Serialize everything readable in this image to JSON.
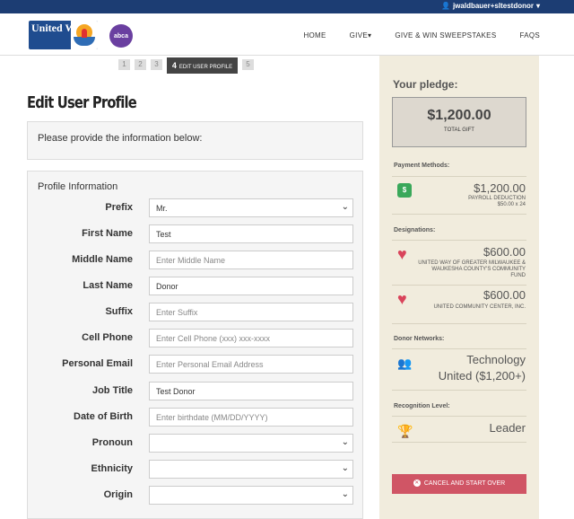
{
  "header": {
    "user": "jwaldbauer+sItestdonor",
    "logo_text": "United Way",
    "partner_logo_text": "abca",
    "nav": [
      "HOME",
      "GIVE",
      "GIVE & WIN SWEEPSTAKES",
      "FAQS"
    ]
  },
  "steps": {
    "items": [
      "1",
      "2",
      "3"
    ],
    "active_number": "4",
    "active_label": "EDIT USER PROFILE",
    "next": "5"
  },
  "page": {
    "title": "Edit User Profile",
    "intro": "Please provide the information below:",
    "section_title": "Profile Information"
  },
  "form": {
    "fields": [
      {
        "label": "Prefix",
        "value": "Mr.",
        "placeholder": "",
        "type": "select"
      },
      {
        "label": "First Name",
        "value": "Test",
        "placeholder": "",
        "type": "text"
      },
      {
        "label": "Middle Name",
        "value": "",
        "placeholder": "Enter Middle Name",
        "type": "text"
      },
      {
        "label": "Last Name",
        "value": "Donor",
        "placeholder": "",
        "type": "text"
      },
      {
        "label": "Suffix",
        "value": "",
        "placeholder": "Enter Suffix",
        "type": "text"
      },
      {
        "label": "Cell Phone",
        "value": "",
        "placeholder": "Enter Cell Phone (xxx) xxx-xxxx",
        "type": "text"
      },
      {
        "label": "Personal Email",
        "value": "",
        "placeholder": "Enter Personal Email Address",
        "type": "text"
      },
      {
        "label": "Job Title",
        "value": "Test Donor",
        "placeholder": "",
        "type": "text"
      },
      {
        "label": "Date of Birth",
        "value": "",
        "placeholder": "Enter birthdate (MM/DD/YYYY)",
        "type": "text"
      },
      {
        "label": "Pronoun",
        "value": "",
        "placeholder": "",
        "type": "select"
      },
      {
        "label": "Ethnicity",
        "value": "",
        "placeholder": "",
        "type": "select"
      },
      {
        "label": "Origin",
        "value": "",
        "placeholder": "",
        "type": "select"
      }
    ]
  },
  "sidebar": {
    "heading": "Your pledge:",
    "total_amount": "$1,200.00",
    "total_label": "TOTAL GIFT",
    "payment_heading": "Payment Methods:",
    "payment_amount": "$1,200.00",
    "payment_label": "PAYROLL DEDUCTION",
    "payment_detail": "$50.00 x 24",
    "designations_heading": "Designations:",
    "designations": [
      {
        "amount": "$600.00",
        "name": "UNITED WAY OF GREATER MILWAUKEE & WAUKESHA COUNTY'S COMMUNITY FUND"
      },
      {
        "amount": "$600.00",
        "name": "UNITED COMMUNITY CENTER, INC."
      }
    ],
    "networks_heading": "Donor Networks:",
    "network_line1": "Technology",
    "network_line2": "United ($1,200+)",
    "recognition_heading": "Recognition Level:",
    "recognition": "Leader",
    "cancel_label": "CANCEL AND START OVER"
  }
}
